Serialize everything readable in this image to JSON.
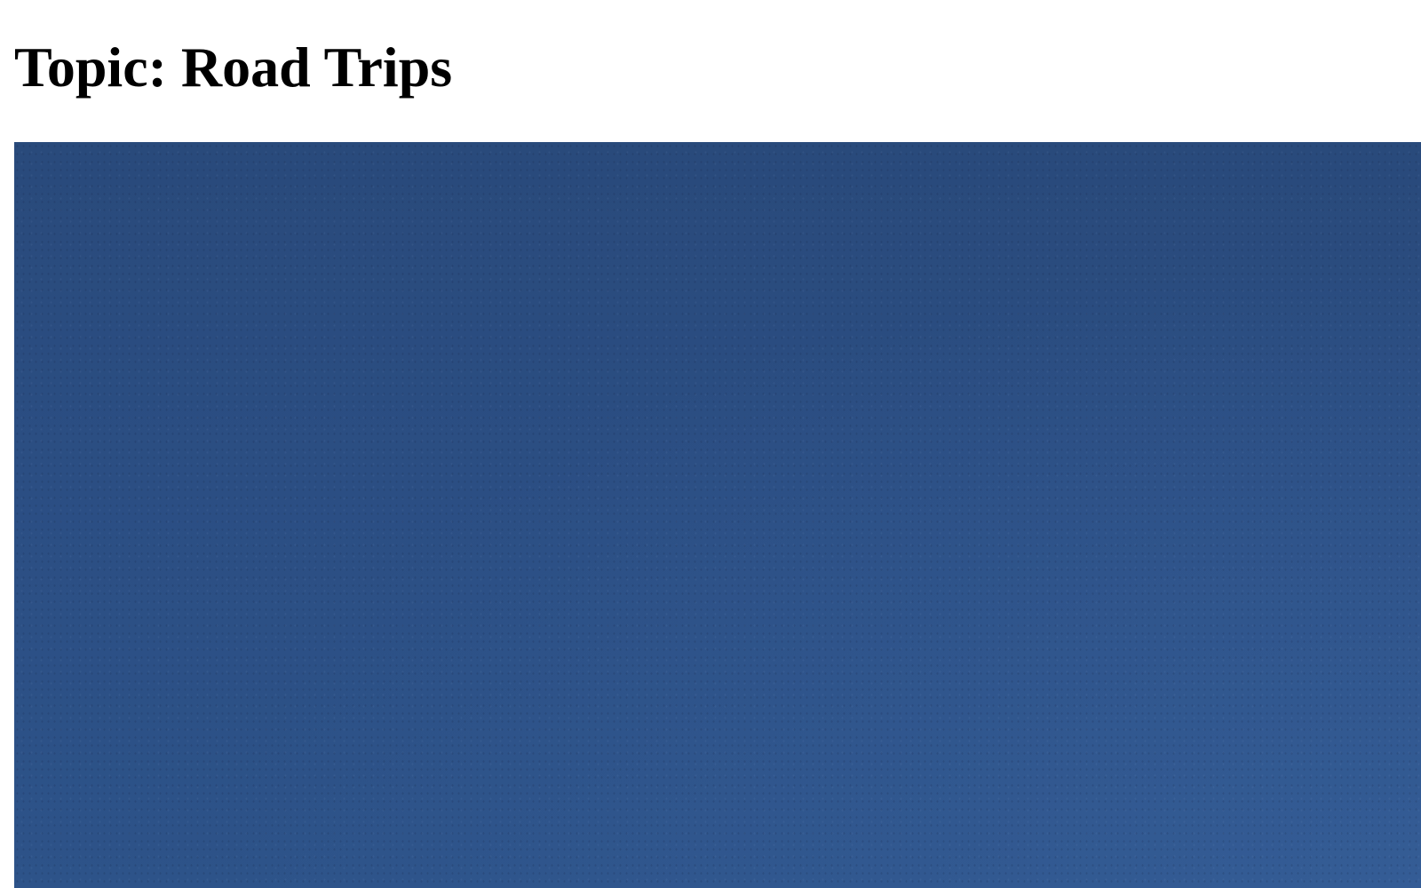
{
  "page": {
    "title": "Topic: Road Trips"
  },
  "hero": {
    "description": "",
    "color_top": "#294a7b",
    "color_bottom": "#2d5389"
  }
}
